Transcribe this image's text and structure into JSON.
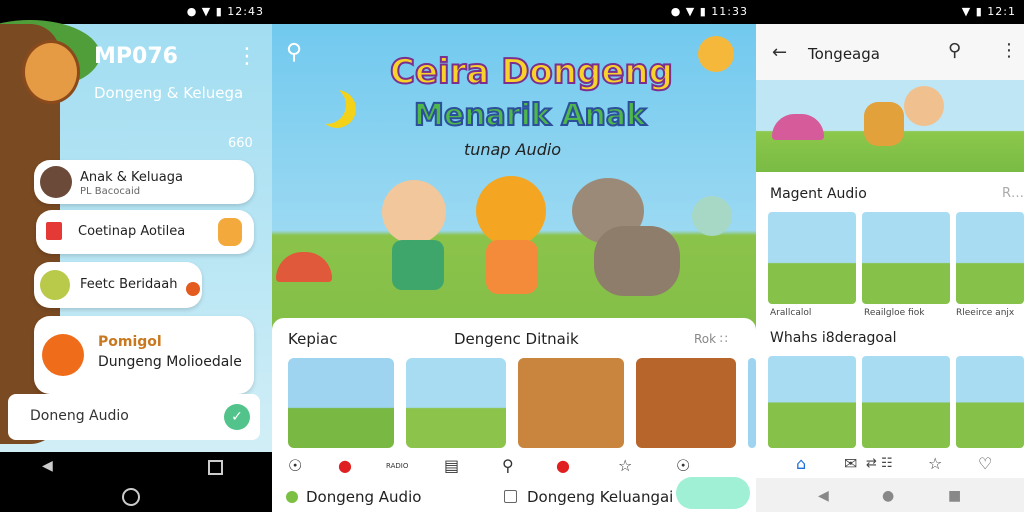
{
  "status": {
    "p1": "● ▼ ▮ 12:43",
    "p2": "● ▼ ▮ 11:33",
    "p3": "▼ ▮ 12:1"
  },
  "panel1": {
    "title": "MP076",
    "subtitle": "Dongeng & Keluega",
    "more_icon": "⋮",
    "count": "660",
    "items": [
      {
        "label": "Anak & Keluaga",
        "sub": "PL Bacocaid"
      },
      {
        "label": "Coetinap Aotilea"
      },
      {
        "label": "Feetc Beridaah"
      },
      {
        "label": "Pomigol",
        "label2": "Dungeng Molioedale"
      }
    ],
    "search_text": "Doneng Audio",
    "go_icon": "✓",
    "nav": {
      "back": "◀",
      "home": "",
      "recent": ""
    }
  },
  "panel2": {
    "search_icon": "⚲",
    "headline1": "Ceira Dongeng",
    "headline2": "Menarik Anak",
    "headline3": "tunap Audio",
    "section_left": "Kepiac",
    "section_center": "Dengenc Ditnaik",
    "section_right": "Rok ∷",
    "tabs": [
      "☉",
      "●",
      "▤",
      "⚲",
      "●",
      "☆",
      "☉"
    ],
    "tab_small_label": "RADIO",
    "option1": "Dongeng Audio",
    "option2": "Dongeng Keluangai"
  },
  "panel3": {
    "title": "Tongeaga",
    "back_icon": "←",
    "search_icon": "⚲",
    "more_icon": "⋮",
    "section1": "Magent Audio",
    "section1_right": "R…",
    "captions": [
      "Arallcalol",
      "Reailgloe fiok",
      "Rleeirce anjx"
    ],
    "section2": "Whahs i8deragoal",
    "tabs": [
      "⌂",
      "✉",
      "⇄ ☷",
      "☆",
      "♡"
    ],
    "nav": [
      "◀",
      "●",
      "■"
    ],
    "accent": "#1e6fd9"
  }
}
